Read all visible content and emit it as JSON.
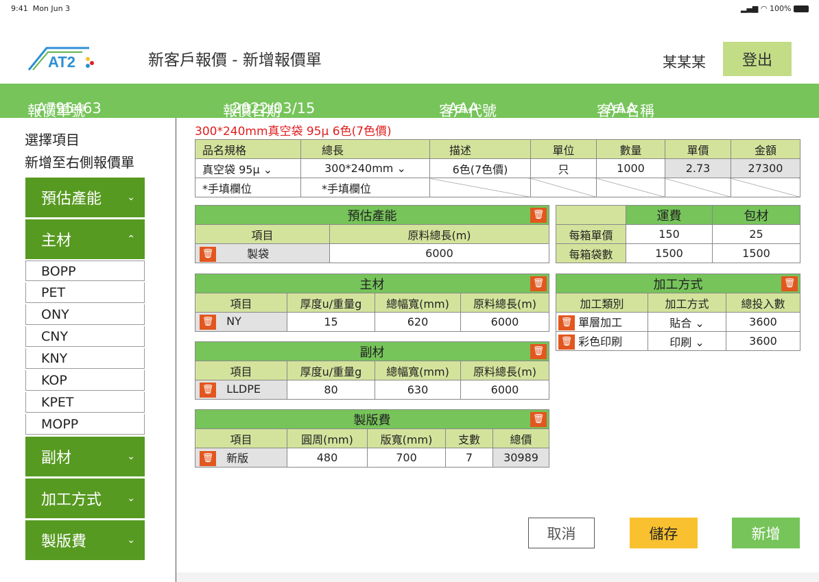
{
  "status_bar": {
    "time": "9:41",
    "date": "Mon Jun 3",
    "battery": "100%"
  },
  "header": {
    "title": "新客戶報價 - 新增報價單",
    "user": "某某某",
    "logout": "登出",
    "logo_text": "AT2"
  },
  "info_bar": {
    "quote_no_label": "報價單號",
    "quote_no": "A795463",
    "date_label": "報價日期",
    "date": "2022/03/15",
    "customer_code_label": "客戶代號",
    "customer_code": "AAA",
    "customer_name_label": "客戶名稱",
    "customer_name": "AAA"
  },
  "sidebar": {
    "hint1": "選擇項目",
    "hint2": "新增至右側報價單",
    "sections": [
      {
        "label": "預估產能",
        "chevron": "⌄"
      },
      {
        "label": "主材",
        "chevron": "⌃"
      },
      {
        "label": "副材",
        "chevron": "⌄"
      },
      {
        "label": "加工方式",
        "chevron": "⌄"
      },
      {
        "label": "製版費",
        "chevron": "⌄"
      }
    ],
    "main_items": [
      "BOPP",
      "PET",
      "ONY",
      "CNY",
      "KNY",
      "KOP",
      "KPET",
      "MOPP"
    ]
  },
  "product_title": "300*240mm真空袋 95µ  6色(7色價)",
  "product_table": {
    "headers": [
      "品名規格",
      "總長",
      "描述",
      "單位",
      "數量",
      "單價",
      "金額"
    ],
    "row": [
      "真空袋 95µ",
      "300*240mm",
      "6色(7色價)",
      "只",
      "1000",
      "2.73",
      "27300"
    ],
    "manual_note1": "*手填欄位",
    "manual_note2": "*手填欄位"
  },
  "capacity": {
    "title": "預估產能",
    "headers": [
      "項目",
      "原料總長(m)"
    ],
    "row": [
      "製袋",
      "6000"
    ]
  },
  "shipping": {
    "headers": [
      "運費",
      "包材"
    ],
    "rows": [
      {
        "label": "每箱單價",
        "values": [
          "150",
          "25"
        ]
      },
      {
        "label": "每箱袋數",
        "values": [
          "1500",
          "1500"
        ]
      }
    ]
  },
  "main_material": {
    "title": "主材",
    "headers": [
      "項目",
      "厚度u/重量g",
      "總幅寬(mm)",
      "原料總長(m)"
    ],
    "row": [
      "NY",
      "15",
      "620",
      "6000"
    ]
  },
  "processing": {
    "title": "加工方式",
    "headers": [
      "加工類別",
      "加工方式",
      "總投入數"
    ],
    "rows": [
      [
        "單層加工",
        "貼合",
        "3600"
      ],
      [
        "彩色印刷",
        "印刷",
        "3600"
      ]
    ]
  },
  "sub_material": {
    "title": "副材",
    "headers": [
      "項目",
      "厚度u/重量g",
      "總幅寬(mm)",
      "原料總長(m)"
    ],
    "row": [
      "LLDPE",
      "80",
      "630",
      "6000"
    ]
  },
  "plate_fee": {
    "title": "製版費",
    "headers": [
      "項目",
      "圓周(mm)",
      "版寬(mm)",
      "支數",
      "總價"
    ],
    "row": [
      "新版",
      "480",
      "700",
      "7",
      "30989"
    ]
  },
  "buttons": {
    "cancel": "取消",
    "save": "儲存",
    "add": "新增"
  },
  "icons": {
    "trash": "🗑",
    "dropdown": "⌄"
  }
}
